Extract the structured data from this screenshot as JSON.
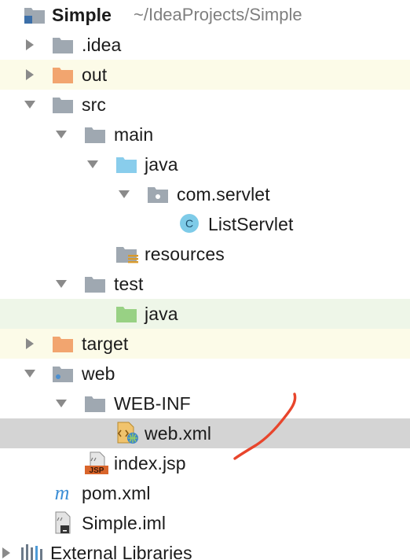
{
  "project": {
    "name": "Simple",
    "path": "~/IdeaProjects/Simple"
  },
  "tree": {
    "idea": ".idea",
    "out": "out",
    "src": "src",
    "main": "main",
    "main_java": "java",
    "com_servlet": "com.servlet",
    "list_servlet": "ListServlet",
    "resources": "resources",
    "test": "test",
    "test_java": "java",
    "target": "target",
    "web": "web",
    "web_inf": "WEB-INF",
    "web_xml": "web.xml",
    "index_jsp": "index.jsp",
    "pom_xml": "pom.xml",
    "simple_iml": "Simple.iml",
    "external_libraries": "External Libraries"
  },
  "icons": {
    "jsp_badge": "JSP",
    "class_badge": "C",
    "maven_badge": "m"
  },
  "colors": {
    "folder_gray": "#9fa8b1",
    "folder_orange": "#f2a56f",
    "folder_blue": "#89cdec",
    "folder_green": "#98d184",
    "row_yellow": "#fcfbe8",
    "row_green": "#eef6e8",
    "row_selected": "#d4d4d4",
    "annotation_red": "#e8452c"
  }
}
